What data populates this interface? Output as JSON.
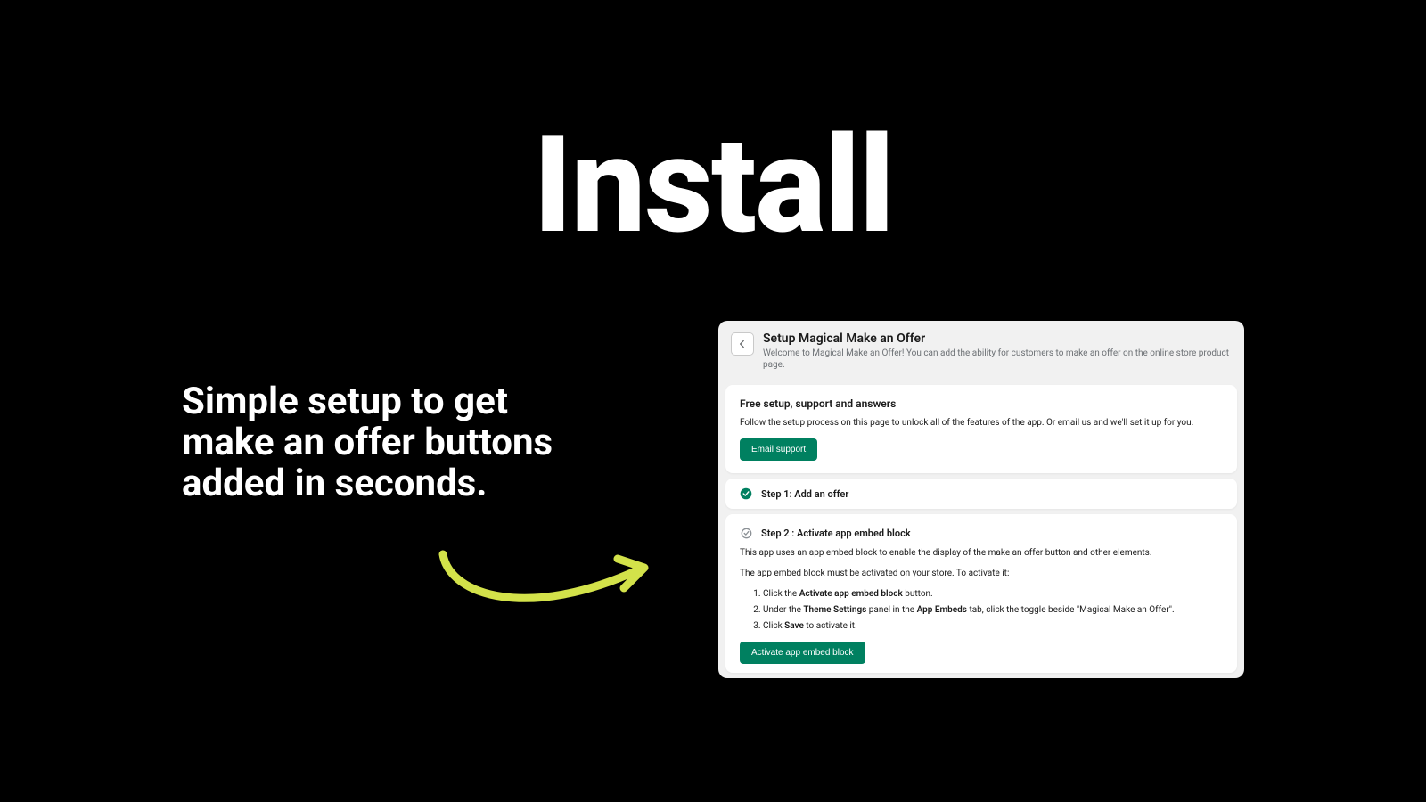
{
  "hero": {
    "title": "Install",
    "subtitle": "Simple setup to get make an offer buttons added in seconds."
  },
  "panel": {
    "header": {
      "title": "Setup Magical Make an Offer",
      "subtitle": "Welcome to Magical Make an Offer! You can add the ability for customers to make an offer on the online store product page."
    },
    "support_card": {
      "title": "Free setup, support and answers",
      "text": "Follow the setup process on this page to unlock all of the features of the app. Or email us and we'll set it up for you.",
      "button": "Email support"
    },
    "step1": {
      "title": "Step 1: Add an offer"
    },
    "step2": {
      "title": "Step 2 : Activate app embed block",
      "intro": "This app uses an app embed block to enable the display of the make an offer button and other elements.",
      "activate_text": "The app embed block must be activated on your store. To activate it:",
      "li1_a": "Click the ",
      "li1_b": "Activate app embed block",
      "li1_c": " button.",
      "li2_a": "Under the ",
      "li2_b": "Theme Settings",
      "li2_c": " panel in the ",
      "li2_d": "App Embeds",
      "li2_e": " tab, click the toggle beside \"Magical Make an Offer\".",
      "li3_a": "Click ",
      "li3_b": "Save",
      "li3_c": " to activate it.",
      "button": "Activate app embed block"
    }
  }
}
